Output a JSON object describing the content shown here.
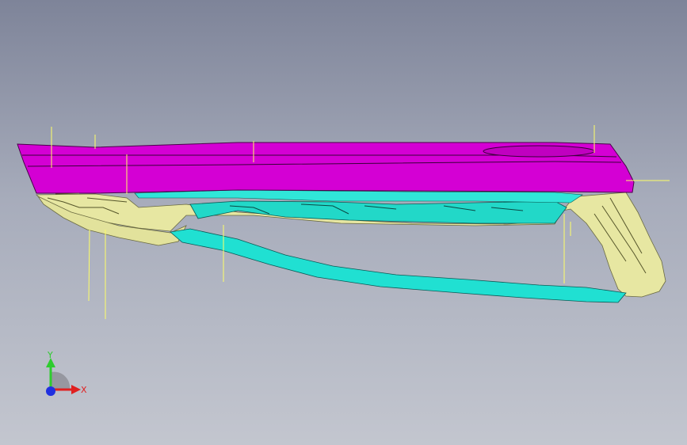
{
  "viewport": {
    "background_top": "#7e8499",
    "background_bottom": "#c3c6cf"
  },
  "model": {
    "description_colors": {
      "outer_panel": "#d400d4",
      "inner_trim": "#e6e6a0",
      "cyan_parts": "#1fe0d0",
      "edge_lines": "#1a1a1a",
      "leader_lines": "#ffff66"
    }
  },
  "triad": {
    "y_label": "Y",
    "x_label": "X",
    "y_color": "#2ecc2e",
    "x_color": "#e02020",
    "z_color": "#2030e0"
  }
}
